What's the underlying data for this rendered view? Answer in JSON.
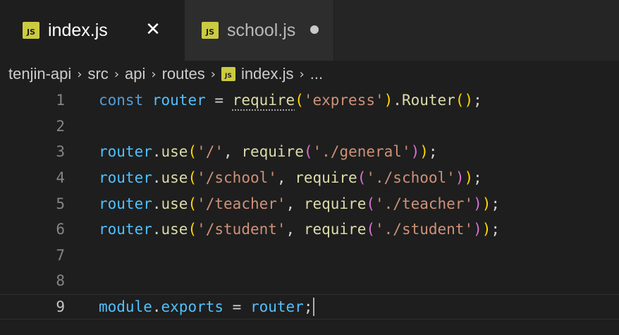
{
  "tabs": [
    {
      "label": "index.js",
      "icon": "JS",
      "active": true,
      "close": "✕"
    },
    {
      "label": "school.js",
      "icon": "JS",
      "active": false,
      "dirty": true
    }
  ],
  "breadcrumb": {
    "items": [
      "tenjin-api",
      "src",
      "api",
      "routes",
      "index.js",
      "..."
    ],
    "separator": "›",
    "file_icon": "JS"
  },
  "editor": {
    "line_numbers": [
      "1",
      "2",
      "3",
      "4",
      "5",
      "6",
      "7",
      "8",
      "9"
    ],
    "current_line": 9,
    "lines": {
      "l1": {
        "kw": "const",
        "var": "router",
        "eq": " = ",
        "fn": "require",
        "op": "(",
        "str": "'express'",
        "cp": ")",
        "dot": ".",
        "fn2": "Router",
        "call": "()",
        "end": ";"
      },
      "l3": {
        "obj": "router",
        "dot": ".",
        "fn": "use",
        "op": "(",
        "path": "'/'",
        "comma": ", ",
        "req": "require",
        "op2": "(",
        "mod": "'./general'",
        "cp2": ")",
        "cp": ")",
        "end": ";"
      },
      "l4": {
        "obj": "router",
        "dot": ".",
        "fn": "use",
        "op": "(",
        "path": "'/school'",
        "comma": ", ",
        "req": "require",
        "op2": "(",
        "mod": "'./school'",
        "cp2": ")",
        "cp": ")",
        "end": ";"
      },
      "l5": {
        "obj": "router",
        "dot": ".",
        "fn": "use",
        "op": "(",
        "path": "'/teacher'",
        "comma": ", ",
        "req": "require",
        "op2": "(",
        "mod": "'./teacher'",
        "cp2": ")",
        "cp": ")",
        "end": ";"
      },
      "l6": {
        "obj": "router",
        "dot": ".",
        "fn": "use",
        "op": "(",
        "path": "'/student'",
        "comma": ", ",
        "req": "require",
        "op2": "(",
        "mod": "'./student'",
        "cp2": ")",
        "cp": ")",
        "end": ";"
      },
      "l9": {
        "obj": "module",
        "dot": ".",
        "prop": "exports",
        "eq": " = ",
        "var": "router",
        "end": ";"
      }
    }
  },
  "colors": {
    "background": "#1e1e1e",
    "keyword": "#569cd6",
    "variable": "#4fc1ff",
    "function": "#dcdcaa",
    "string": "#ce9178",
    "js_icon": "#cbcb41"
  }
}
